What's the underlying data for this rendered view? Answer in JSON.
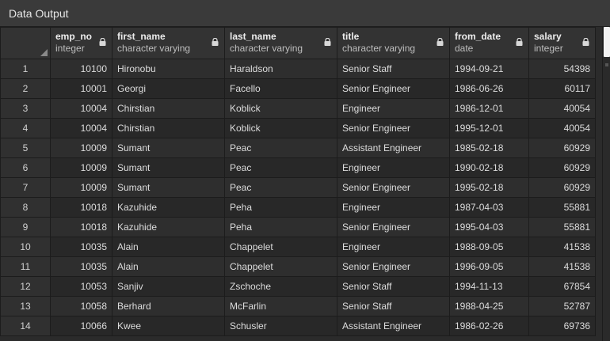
{
  "panel": {
    "title": "Data Output"
  },
  "columns": [
    {
      "name": "emp_no",
      "type": "integer"
    },
    {
      "name": "first_name",
      "type": "character varying"
    },
    {
      "name": "last_name",
      "type": "character varying"
    },
    {
      "name": "title",
      "type": "character varying"
    },
    {
      "name": "from_date",
      "type": "date"
    },
    {
      "name": "salary",
      "type": "integer"
    }
  ],
  "rows": [
    {
      "n": "1",
      "emp_no": "10100",
      "first_name": "Hironobu",
      "last_name": "Haraldson",
      "title": "Senior Staff",
      "from_date": "1994-09-21",
      "salary": "54398"
    },
    {
      "n": "2",
      "emp_no": "10001",
      "first_name": "Georgi",
      "last_name": "Facello",
      "title": "Senior Engineer",
      "from_date": "1986-06-26",
      "salary": "60117"
    },
    {
      "n": "3",
      "emp_no": "10004",
      "first_name": "Chirstian",
      "last_name": "Koblick",
      "title": "Engineer",
      "from_date": "1986-12-01",
      "salary": "40054"
    },
    {
      "n": "4",
      "emp_no": "10004",
      "first_name": "Chirstian",
      "last_name": "Koblick",
      "title": "Senior Engineer",
      "from_date": "1995-12-01",
      "salary": "40054"
    },
    {
      "n": "5",
      "emp_no": "10009",
      "first_name": "Sumant",
      "last_name": "Peac",
      "title": "Assistant Engineer",
      "from_date": "1985-02-18",
      "salary": "60929"
    },
    {
      "n": "6",
      "emp_no": "10009",
      "first_name": "Sumant",
      "last_name": "Peac",
      "title": "Engineer",
      "from_date": "1990-02-18",
      "salary": "60929"
    },
    {
      "n": "7",
      "emp_no": "10009",
      "first_name": "Sumant",
      "last_name": "Peac",
      "title": "Senior Engineer",
      "from_date": "1995-02-18",
      "salary": "60929"
    },
    {
      "n": "8",
      "emp_no": "10018",
      "first_name": "Kazuhide",
      "last_name": "Peha",
      "title": "Engineer",
      "from_date": "1987-04-03",
      "salary": "55881"
    },
    {
      "n": "9",
      "emp_no": "10018",
      "first_name": "Kazuhide",
      "last_name": "Peha",
      "title": "Senior Engineer",
      "from_date": "1995-04-03",
      "salary": "55881"
    },
    {
      "n": "10",
      "emp_no": "10035",
      "first_name": "Alain",
      "last_name": "Chappelet",
      "title": "Engineer",
      "from_date": "1988-09-05",
      "salary": "41538"
    },
    {
      "n": "11",
      "emp_no": "10035",
      "first_name": "Alain",
      "last_name": "Chappelet",
      "title": "Senior Engineer",
      "from_date": "1996-09-05",
      "salary": "41538"
    },
    {
      "n": "12",
      "emp_no": "10053",
      "first_name": "Sanjiv",
      "last_name": "Zschoche",
      "title": "Senior Staff",
      "from_date": "1994-11-13",
      "salary": "67854"
    },
    {
      "n": "13",
      "emp_no": "10058",
      "first_name": "Berhard",
      "last_name": "McFarlin",
      "title": "Senior Staff",
      "from_date": "1988-04-25",
      "salary": "52787"
    },
    {
      "n": "14",
      "emp_no": "10066",
      "first_name": "Kwee",
      "last_name": "Schusler",
      "title": "Assistant Engineer",
      "from_date": "1986-02-26",
      "salary": "69736"
    }
  ],
  "icons": {
    "column_lock": "lock-icon",
    "select_all": "corner-triangle-icon"
  },
  "colors": {
    "background": "#2b2b2b",
    "header": "#3a3a3a",
    "grid_line": "#1c1c1c"
  }
}
